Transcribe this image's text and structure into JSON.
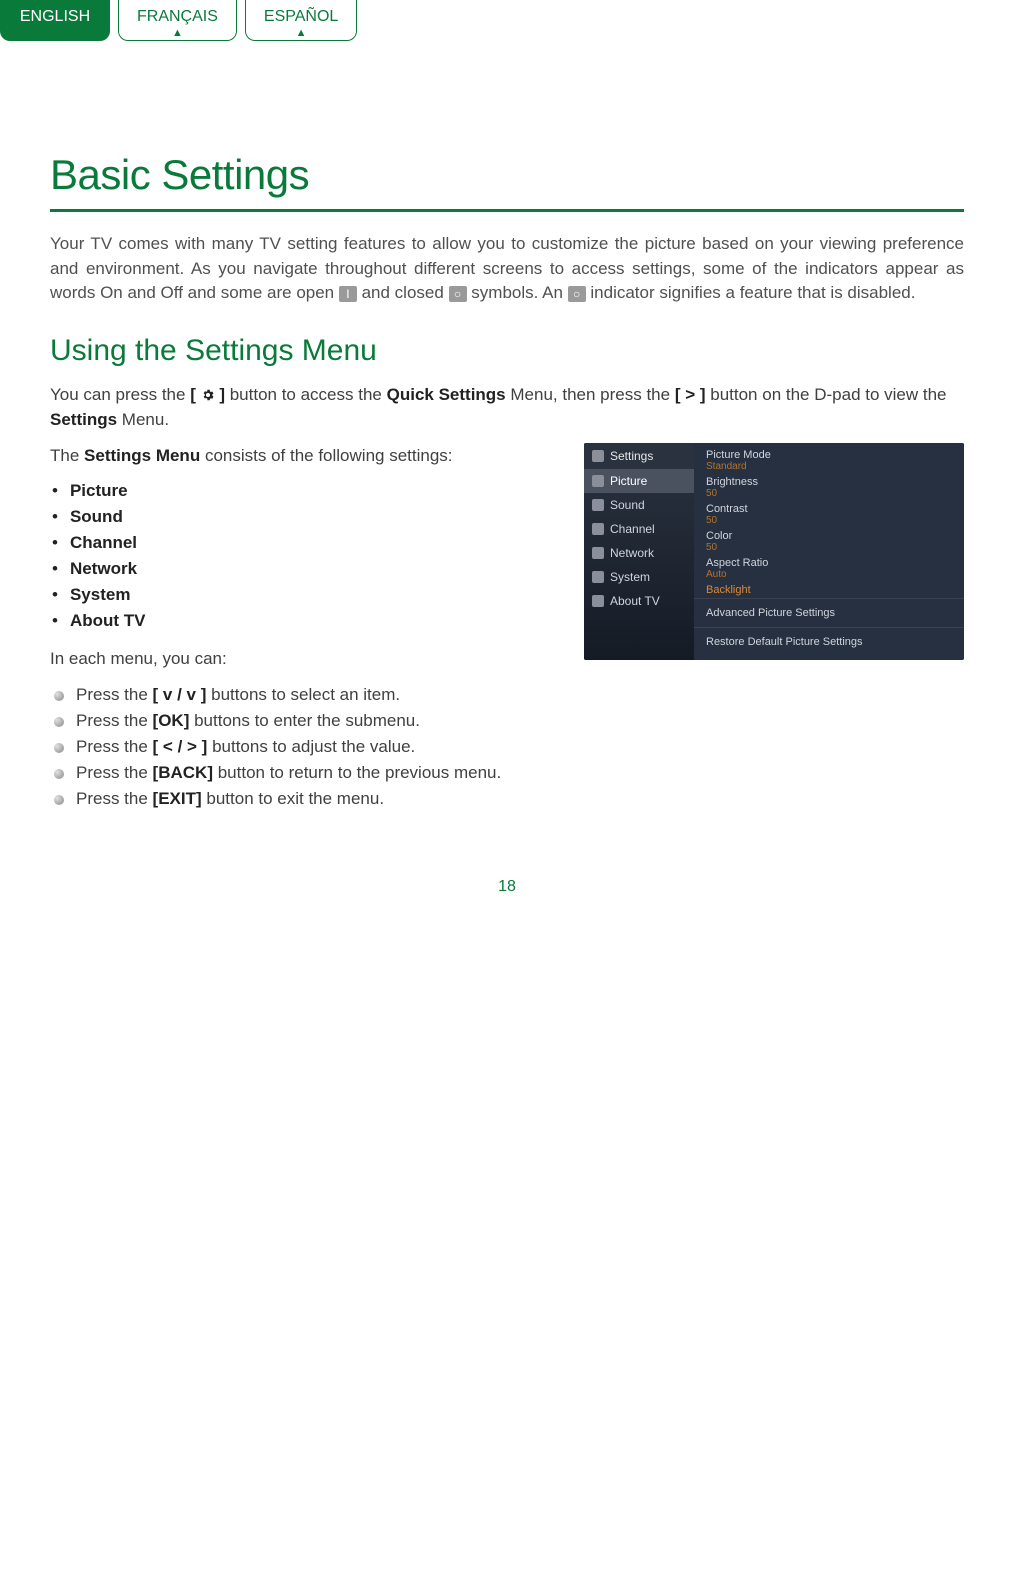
{
  "tabs": {
    "english": "ENGLISH",
    "francais": "FRANÇAIS",
    "espanol": "ESPAÑOL"
  },
  "title": "Basic Settings",
  "intro": {
    "p1a": "Your TV comes with many TV setting features to allow you to customize the picture based on your viewing preference and environment. As you navigate throughout different screens to access settings, some of the indicators appear as words On and Off and some are open ",
    "p1b": " and closed ",
    "p1c": " symbols. An ",
    "p1d": " indicator signifies a feature that is disabled.",
    "sym_open_label": "I",
    "sym_closed_label": "○",
    "sym_disabled_label": "○"
  },
  "section2_title": "Using the Settings Menu",
  "para2": {
    "a": "You can press the ",
    "b": " button to access the ",
    "c": "Quick Settings",
    "d": " Menu, then press the ",
    "e": "[ > ]",
    "f": " button on the D-pad to view the ",
    "g": "Settings",
    "h": " Menu."
  },
  "para3a": "The ",
  "para3b": "Settings Menu",
  "para3c": " consists of the following settings:",
  "settings_items": [
    "Picture",
    "Sound",
    "Channel",
    "Network",
    "System",
    "About TV"
  ],
  "para4": "In each menu, you can:",
  "actions": [
    {
      "a": "Press the ",
      "b": "[ v / v ]",
      "c": " buttons to select an item."
    },
    {
      "a": "Press the ",
      "b": "[OK]",
      "c": " buttons to enter the submenu."
    },
    {
      "a": "Press the ",
      "b": "[ < / > ]",
      "c": " buttons to adjust the value."
    },
    {
      "a": "Press the ",
      "b": "[BACK]",
      "c": " button to return to the previous menu."
    },
    {
      "a": "Press the ",
      "b": "[EXIT]",
      "c": " button to exit the menu."
    }
  ],
  "tv": {
    "title": "Settings",
    "left_items": [
      "Picture",
      "Sound",
      "Channel",
      "Network",
      "System",
      "About TV"
    ],
    "right_rows": [
      {
        "label": "Picture Mode",
        "value": "Standard"
      },
      {
        "label": "Brightness",
        "value": "50"
      },
      {
        "label": "Contrast",
        "value": "50"
      },
      {
        "label": "Color",
        "value": "50"
      },
      {
        "label": "Aspect Ratio",
        "value": "Auto"
      },
      {
        "label": "Backlight",
        "value": ""
      }
    ],
    "adv": "Advanced Picture Settings",
    "restore": "Restore Default Picture Settings"
  },
  "page_number": "18"
}
